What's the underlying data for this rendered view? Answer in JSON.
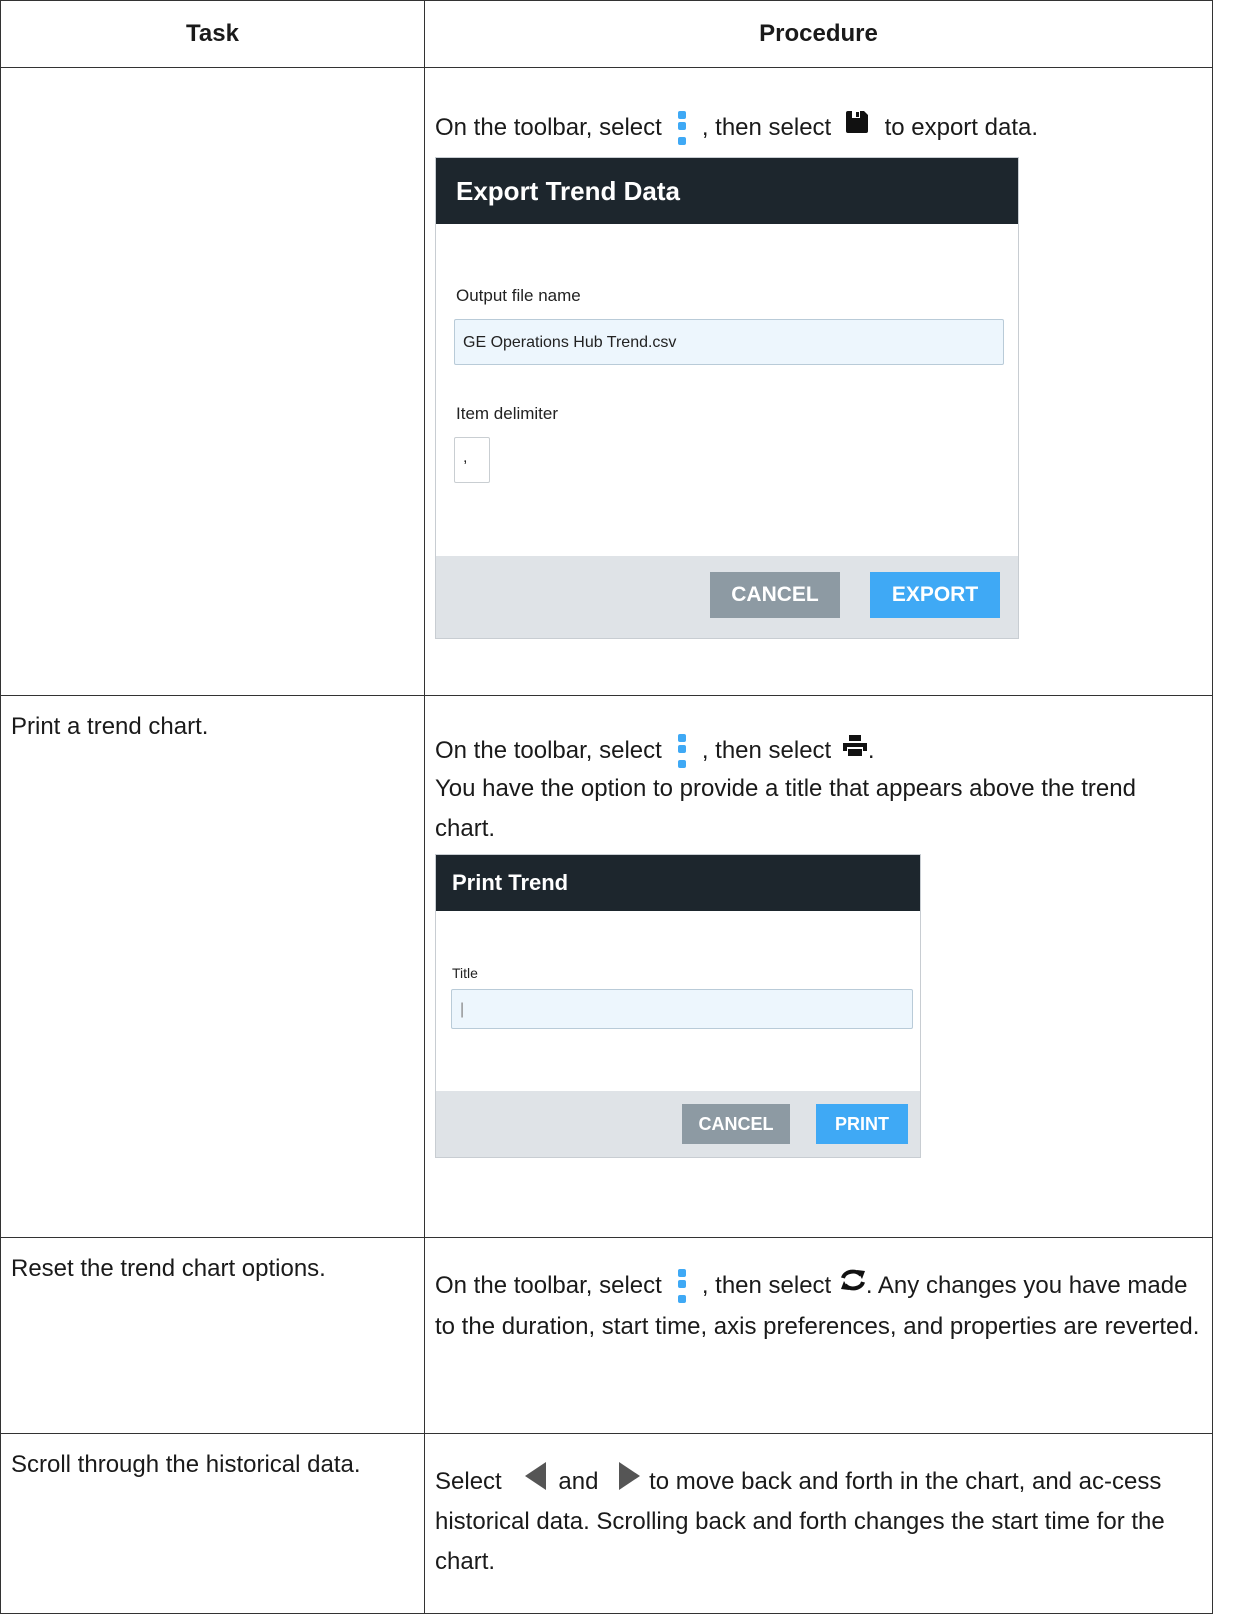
{
  "header": {
    "task": "Task",
    "procedure": "Procedure"
  },
  "rows": [
    {
      "task": "",
      "proc_a": "On the toolbar, select",
      "proc_b": ", then select",
      "proc_c": "to export data.",
      "dialog": {
        "title": "Export Trend Data",
        "field1_label": "Output file name",
        "field1_value": "GE Operations Hub Trend.csv",
        "field2_label": "Item delimiter",
        "field2_value": ",",
        "cancel": "CANCEL",
        "primary": "EXPORT"
      }
    },
    {
      "task": "Print a trend chart.",
      "proc_a": "On the toolbar, select",
      "proc_b": ", then select",
      "proc_c": ".",
      "proc_d": "You have the option to provide a title that appears above the trend chart.",
      "dialog": {
        "title": "Print Trend",
        "field1_label": "Title",
        "field1_value": "|",
        "cancel": "CANCEL",
        "primary": "PRINT"
      }
    },
    {
      "task": "Reset the trend chart options.",
      "proc_a": "On the toolbar, select",
      "proc_b": ", then select",
      "proc_c": ". Any changes you have made to the duration, start time, axis preferences, and properties are reverted."
    },
    {
      "task": "Scroll through the historical data.",
      "proc_a": "Select",
      "proc_b": "and",
      "proc_c": "to move back and forth in the chart, and ac-cess historical data. Scrolling back and forth changes the start time for the chart."
    }
  ],
  "icons": {
    "menu": "kebab-menu-icon",
    "save": "save-disk-icon",
    "print": "printer-icon",
    "refresh": "refresh-icon",
    "left": "left-arrow-icon",
    "right": "right-arrow-icon"
  },
  "colors": {
    "accent": "#3fa9f5",
    "dialog_header": "#1d262d",
    "cancel_button": "#8d9aa3"
  }
}
